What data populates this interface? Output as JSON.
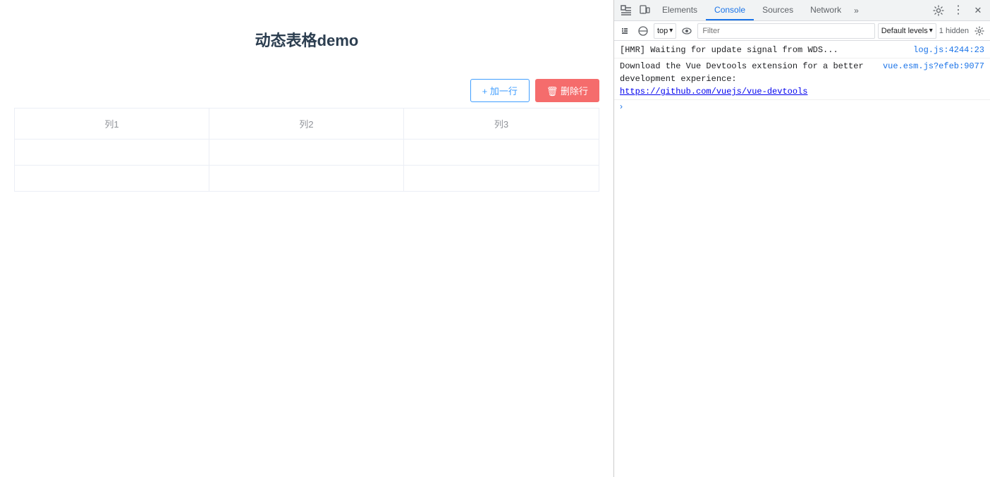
{
  "app": {
    "title": "动态表格demo"
  },
  "toolbar": {
    "add_row_label": "+ 加一行",
    "delete_row_label": "🗑 删除行"
  },
  "table": {
    "headers": [
      "列1",
      "列2",
      "列3"
    ],
    "rows": [
      [
        "",
        "",
        ""
      ],
      [
        "",
        "",
        ""
      ]
    ]
  },
  "devtools": {
    "tabs": [
      "Elements",
      "Console",
      "Sources",
      "Network"
    ],
    "active_tab": "Console",
    "more_label": "»",
    "toolbar": {
      "context": "top",
      "filter_placeholder": "Filter",
      "default_levels": "Default levels",
      "hidden_count": "1 hidden"
    },
    "console": {
      "lines": [
        {
          "text": "[HMR] Waiting for update signal from WDS...",
          "link_text": "log.js:4244:23",
          "link_href": "#"
        },
        {
          "text": "Download the Vue Devtools extension for a better\ndevelopment experience:",
          "link_text": "vue.esm.js?efeb:9077",
          "link_href": "https://github.com/vuejs/vue-devtools"
        },
        {
          "text": "https://github.com/vuejs/vue-devtools",
          "link_text": "",
          "link_href": "https://github.com/vuejs/vue-devtools"
        }
      ],
      "arrow_text": "›"
    }
  },
  "icons": {
    "inspect": "⬚",
    "device": "▭",
    "close": "✕",
    "settings_gear": "⚙",
    "more_vert": "⋮",
    "stop": "⊘",
    "down_arrow": "▾",
    "eye": "👁",
    "gear_small": "⚙"
  }
}
